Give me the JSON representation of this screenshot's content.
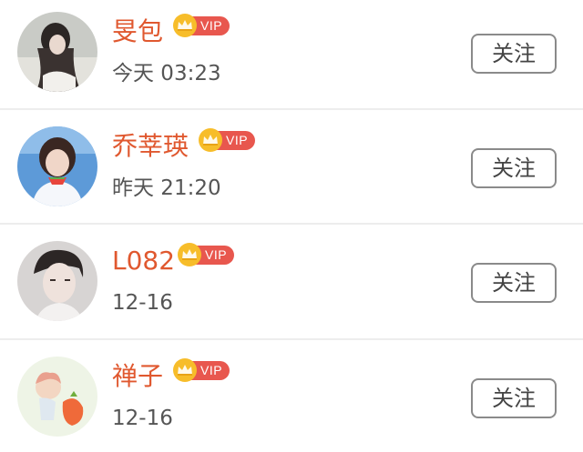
{
  "users": [
    {
      "name": "旻包",
      "badge": "VIP",
      "time": "今天 03:23",
      "follow_label": "关注"
    },
    {
      "name": "乔莘瑛",
      "badge": "VIP",
      "time": "昨天 21:20",
      "follow_label": "关注"
    },
    {
      "name": "L082",
      "badge": "VIP",
      "time": "12-16",
      "follow_label": "关注"
    },
    {
      "name": "禅子",
      "badge": "VIP",
      "time": "12-16",
      "follow_label": "关注"
    }
  ],
  "colors": {
    "name": "#e0582f",
    "vip_tag": "#e8574e",
    "vip_crown": "#f7bd2a",
    "time": "#555555",
    "button_border": "#8a8a8a"
  }
}
